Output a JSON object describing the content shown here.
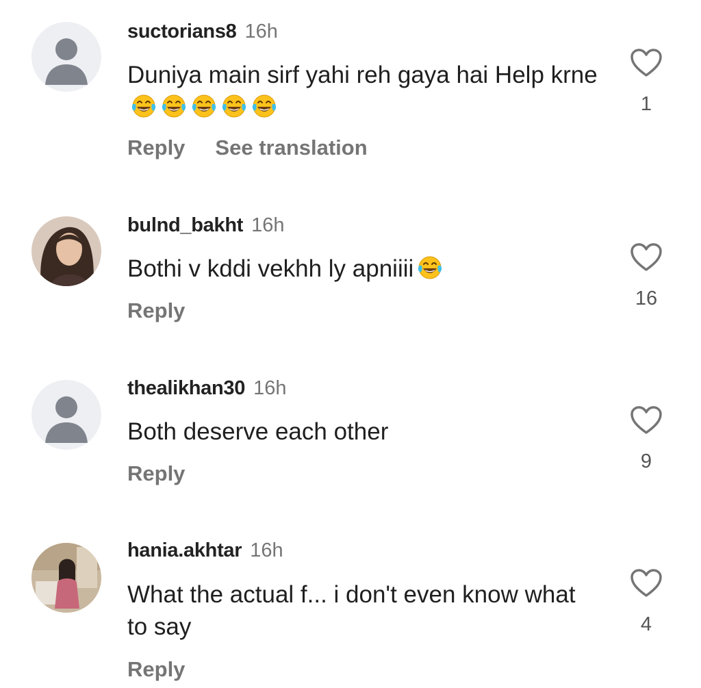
{
  "comments": [
    {
      "username": "suctorians8",
      "time": "16h",
      "text": "Duniya main sirf yahi reh gaya hai Help krne😂😂😂😂😂",
      "reply_label": "Reply",
      "translate_label": "See translation",
      "likes": "1",
      "avatar": "default-avatar-icon"
    },
    {
      "username": "bulnd_bakht",
      "time": "16h",
      "text": "Bothi v kddi vekhh ly apniiii😂",
      "reply_label": "Reply",
      "likes": "16",
      "avatar": "profile-photo"
    },
    {
      "username": "thealikhan30",
      "time": "16h",
      "text": "Both deserve each other",
      "reply_label": "Reply",
      "likes": "9",
      "avatar": "default-avatar-icon"
    },
    {
      "username": "hania.akhtar",
      "time": "16h",
      "text": "What the actual f... i don't even know what to say",
      "reply_label": "Reply",
      "likes": "4",
      "avatar": "profile-photo"
    }
  ],
  "colors": {
    "username": "#222222",
    "secondary_text": "#757575",
    "default_avatar_bg": "#eeeff3",
    "default_avatar_figure": "#7f848d",
    "emoji_face": "#fcc21b",
    "emoji_tears": "#40c0e7"
  }
}
